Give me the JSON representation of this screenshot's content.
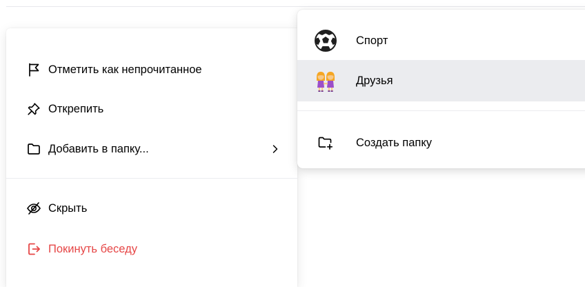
{
  "main_menu": {
    "items": [
      {
        "label": "Отметить как непрочитанное",
        "icon": "flag-icon"
      },
      {
        "label": "Открепить",
        "icon": "unpin-icon"
      },
      {
        "label": "Добавить в папку...",
        "icon": "folder-icon",
        "has_submenu": true
      },
      {
        "label": "Скрыть",
        "icon": "eye-slash-icon"
      },
      {
        "label": "Покинуть беседу",
        "icon": "logout-icon",
        "color": "#e64646"
      }
    ]
  },
  "folder_submenu": {
    "items": [
      {
        "label": "Спорт",
        "icon": "soccer-ball-icon"
      },
      {
        "label": "Друзья",
        "icon": "friends-icon",
        "highlighted": true
      },
      {
        "label": "Создать папку",
        "icon": "folder-plus-icon"
      }
    ]
  },
  "colors": {
    "danger": "#e64646",
    "highlight": "#ebecef",
    "icon": "#000000"
  }
}
